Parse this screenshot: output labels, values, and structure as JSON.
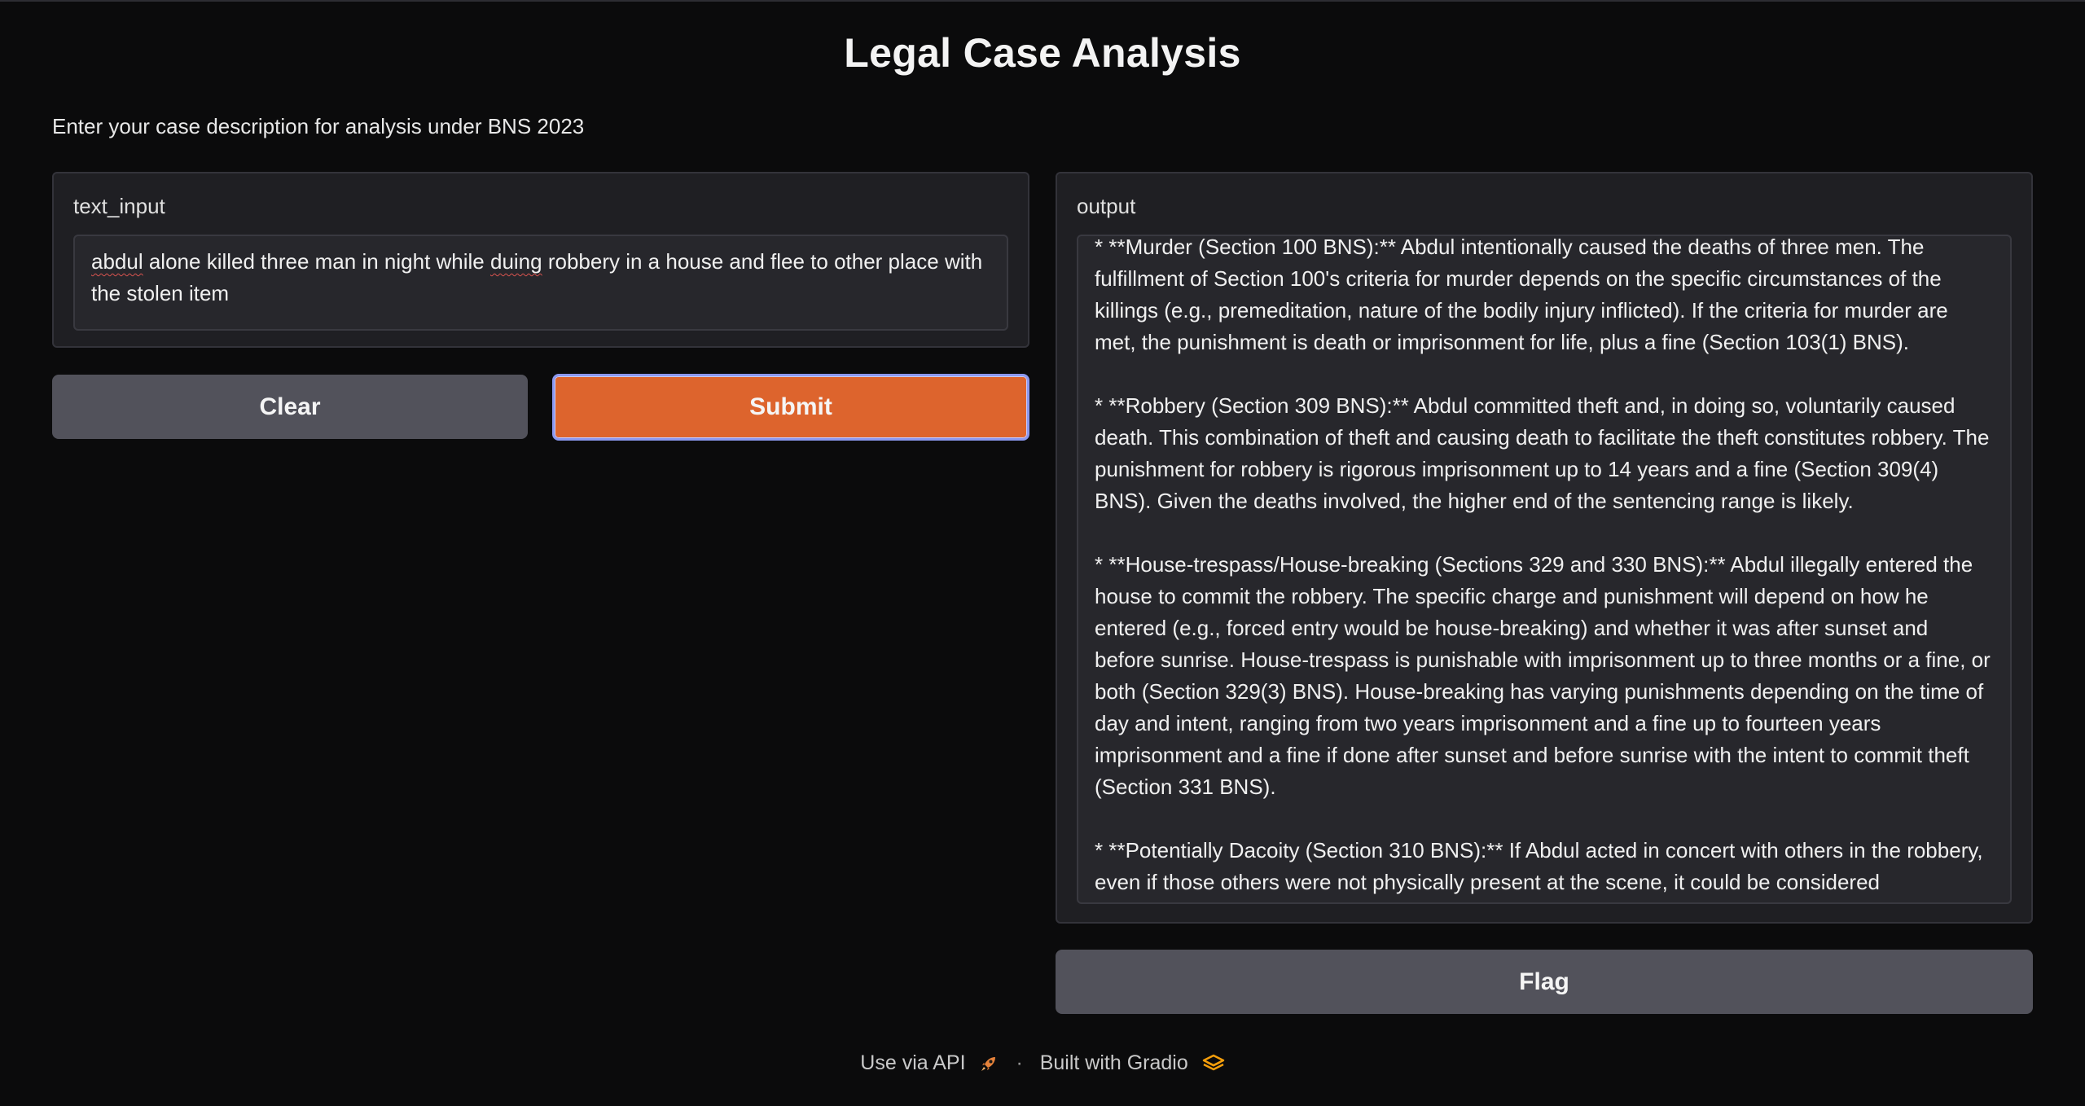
{
  "header": {
    "title": "Legal Case Analysis",
    "description": "Enter your case description for analysis under BNS 2023"
  },
  "input": {
    "label": "text_input",
    "value_parts": [
      "abdul",
      "  alone killed three man in night while ",
      "duing",
      " robbery in a house  and flee  to other place with the stolen item"
    ]
  },
  "output": {
    "label": "output",
    "paragraphs": [
      "* **Murder (Section 100 BNS):**  Abdul intentionally caused the deaths of three men. The fulfillment of Section 100's criteria for murder depends on the specific circumstances of the killings (e.g., premeditation, nature of the bodily injury inflicted).  If the criteria for murder are met, the punishment is death or imprisonment for life, plus a fine (Section 103(1) BNS).",
      "* **Robbery (Section 309 BNS):** Abdul committed theft and, in doing so, voluntarily caused death. This combination of theft and causing death to facilitate the theft constitutes robbery. The punishment for robbery is rigorous imprisonment up to 14 years and a fine (Section 309(4) BNS).  Given the deaths involved, the higher end of the sentencing range is likely.",
      "* **House-trespass/House-breaking (Sections 329 and 330 BNS):** Abdul illegally entered the house to commit the robbery.  The specific charge and punishment will depend on how he entered (e.g., forced entry would be house-breaking) and whether it was after sunset and before sunrise.  House-trespass is punishable with imprisonment up to three months or a fine, or both (Section 329(3) BNS). House-breaking has varying punishments depending on the time of day and intent, ranging from two years imprisonment and a fine up to fourteen years imprisonment and a fine if done after sunset and before sunrise with the intent to commit theft (Section 331 BNS).",
      "* **Potentially Dacoity (Section 310 BNS):** If Abdul acted in concert with others in the robbery, even if those others were not physically present at the scene, it could be considered"
    ]
  },
  "buttons": {
    "clear": "Clear",
    "submit": "Submit",
    "flag": "Flag"
  },
  "footer": {
    "api_link": "Use via API",
    "separator": "·",
    "built_with": "Built with Gradio",
    "api_icon": "rocket-icon",
    "gradio_icon": "gradio-logo-icon"
  },
  "colors": {
    "background": "#0b0b0c",
    "panel": "#1f1f23",
    "submit": "#dd642d",
    "secondary_button": "#52525b",
    "focus_ring": "#8b98f0"
  }
}
